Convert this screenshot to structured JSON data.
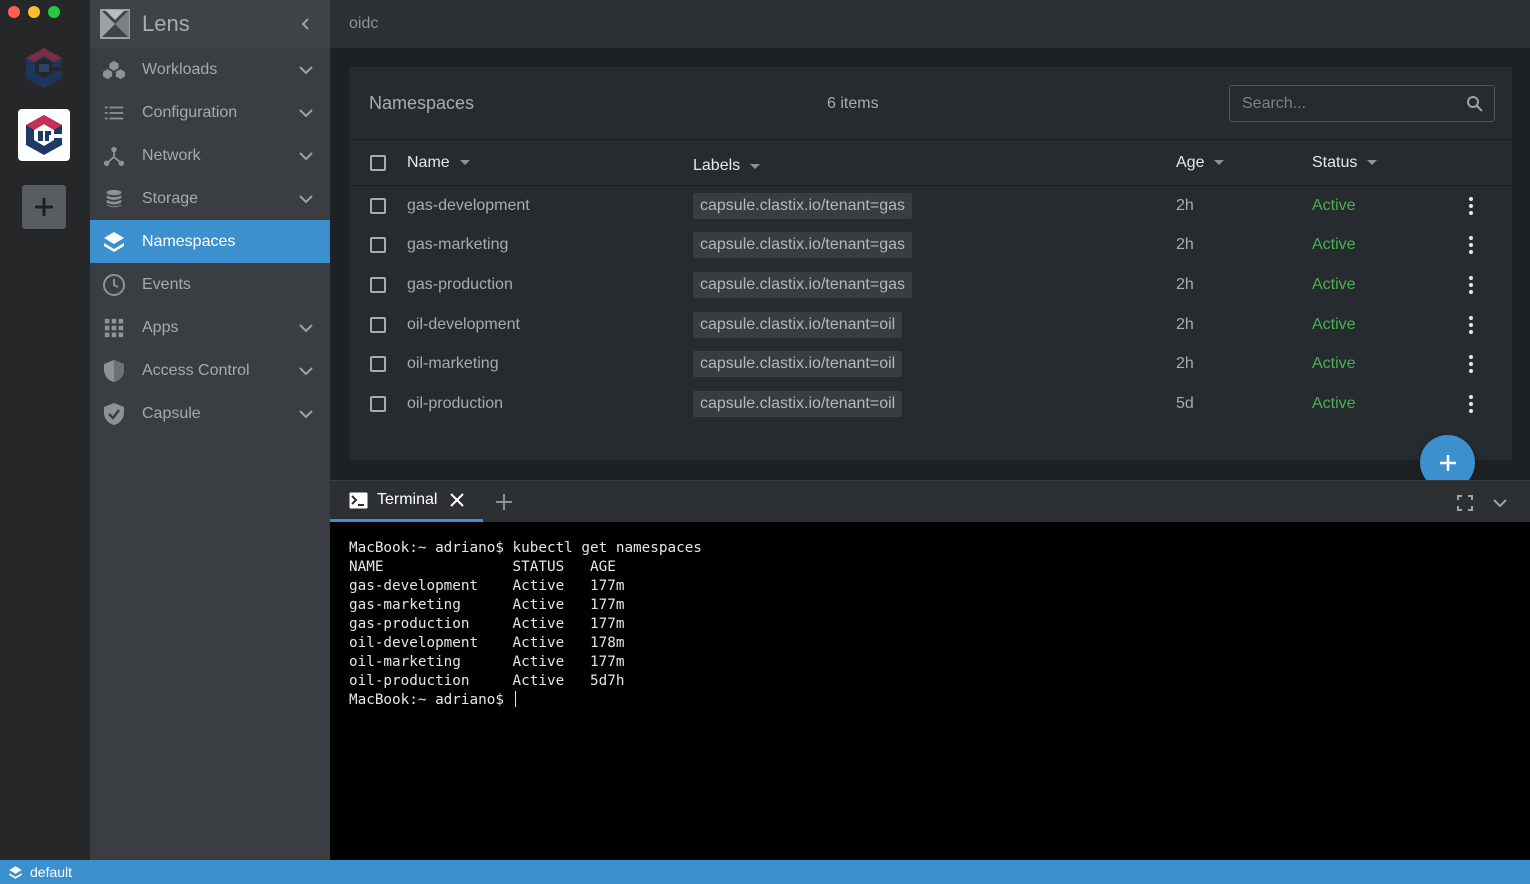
{
  "app": {
    "name": "Lens",
    "header_title": "oidc"
  },
  "sidebar": {
    "items": [
      {
        "label": "Workloads",
        "icon": "workloads-icon",
        "expandable": true
      },
      {
        "label": "Configuration",
        "icon": "list-icon",
        "expandable": true
      },
      {
        "label": "Network",
        "icon": "network-icon",
        "expandable": true
      },
      {
        "label": "Storage",
        "icon": "storage-icon",
        "expandable": true
      },
      {
        "label": "Namespaces",
        "icon": "layers-icon",
        "expandable": false,
        "active": true
      },
      {
        "label": "Events",
        "icon": "clock-icon",
        "expandable": false
      },
      {
        "label": "Apps",
        "icon": "apps-grid-icon",
        "expandable": true
      },
      {
        "label": "Access Control",
        "icon": "shield-icon",
        "expandable": true
      },
      {
        "label": "Capsule",
        "icon": "shield-check-icon",
        "expandable": true
      }
    ]
  },
  "namespaces": {
    "title": "Namespaces",
    "count": "6 items",
    "search_placeholder": "Search...",
    "columns": {
      "name": "Name",
      "labels": "Labels",
      "age": "Age",
      "status": "Status"
    },
    "rows": [
      {
        "name": "gas-development",
        "label": "capsule.clastix.io/tenant=gas",
        "age": "2h",
        "status": "Active"
      },
      {
        "name": "gas-marketing",
        "label": "capsule.clastix.io/tenant=gas",
        "age": "2h",
        "status": "Active"
      },
      {
        "name": "gas-production",
        "label": "capsule.clastix.io/tenant=gas",
        "age": "2h",
        "status": "Active"
      },
      {
        "name": "oil-development",
        "label": "capsule.clastix.io/tenant=oil",
        "age": "2h",
        "status": "Active"
      },
      {
        "name": "oil-marketing",
        "label": "capsule.clastix.io/tenant=oil",
        "age": "2h",
        "status": "Active"
      },
      {
        "name": "oil-production",
        "label": "capsule.clastix.io/tenant=oil",
        "age": "5d",
        "status": "Active"
      }
    ]
  },
  "dock": {
    "tab_label": "Terminal"
  },
  "terminal": {
    "lines": [
      "MacBook:~ adriano$ kubectl get namespaces",
      "NAME               STATUS   AGE",
      "gas-development    Active   177m",
      "gas-marketing      Active   177m",
      "gas-production     Active   177m",
      "oil-development    Active   178m",
      "oil-marketing      Active   177m",
      "oil-production     Active   5d7h"
    ],
    "prompt": "MacBook:~ adriano$ "
  },
  "statusbar": {
    "namespace": "default"
  },
  "colors": {
    "accent": "#3d90ce",
    "active_status": "#4caf50"
  }
}
